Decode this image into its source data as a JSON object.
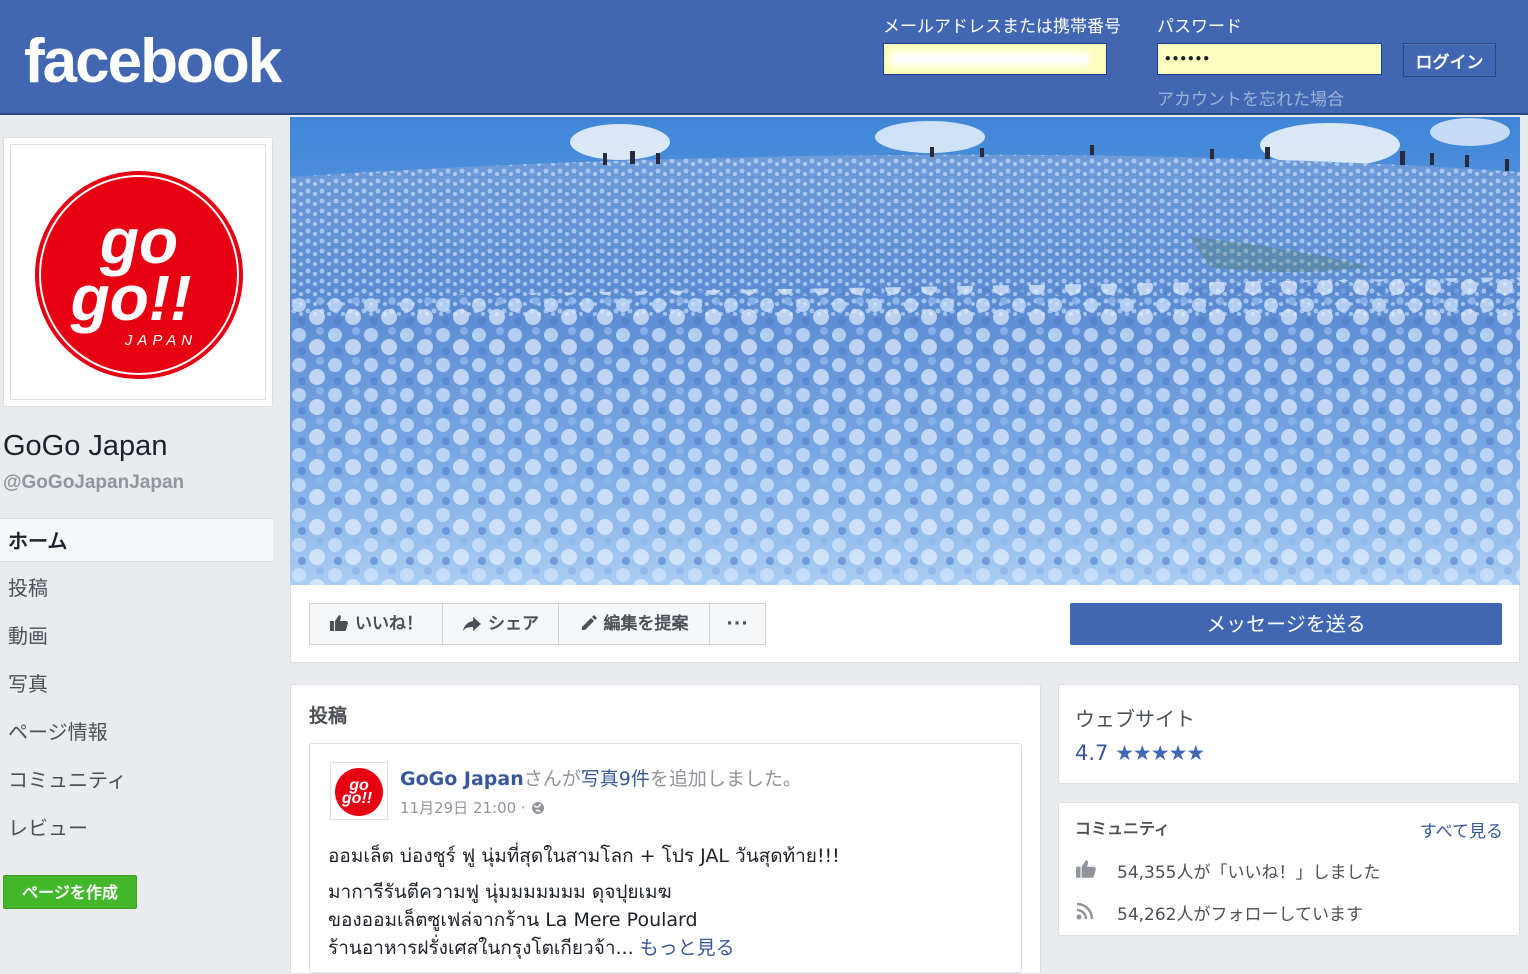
{
  "header": {
    "logo": "facebook",
    "email_label": "メールアドレスまたは携帯番号",
    "password_label": "パスワード",
    "password_value": "••••••",
    "login_button": "ログイン",
    "forgot_link": "アカウントを忘れた場合"
  },
  "profile": {
    "name": "GoGo Japan",
    "handle": "@GoGoJapanJapan",
    "logo_text_1": "go",
    "logo_text_2": "go!!",
    "logo_text_3": "JAPAN"
  },
  "nav": {
    "items": [
      "ホーム",
      "投稿",
      "動画",
      "写真",
      "ページ情報",
      "コミュニティ",
      "レビュー"
    ],
    "create_page": "ページを作成"
  },
  "actions": {
    "like": "いいね！",
    "share": "シェア",
    "suggest_edit": "編集を提案",
    "more": "···",
    "send_message": "メッセージを送る"
  },
  "posts": {
    "title": "投稿",
    "author": "GoGo Japan",
    "added_prefix": "さんが",
    "photos_link": "写真9件",
    "added_suffix": "を追加しました。",
    "timestamp": "11月29日 21:00 ·",
    "line1": "ออมเล็ต บ่องชูร์ ฟู นุ่มที่สุดในสามโลก + โปร JAL วันสุดท้าย!!!",
    "line2": "มาการีรันตีความฟู นุ่มมมมมมม ดุจปุยเมฆ",
    "line3": "ของออมเล็ตซูเฟล่จากร้าน La Mere Poulard",
    "line4": "ร้านอาหารฝรั่งเศสในกรุงโตเกียวจ้า...",
    "see_more": "もっと見る"
  },
  "sidebar": {
    "website_title": "ウェブサイト",
    "rating_value": "4.7",
    "rating_stars": "★★★★★",
    "community_title": "コミュニティ",
    "see_all": "すべて見る",
    "likes_text": "54,355人が「いいね！」しました",
    "follows_text": "54,262人がフォローしています"
  },
  "colors": {
    "header_blue": "#4267b2",
    "link_blue": "#365899",
    "green_button": "#42b72a",
    "logo_red": "#e60012",
    "autofill_yellow": "#faffbd"
  }
}
